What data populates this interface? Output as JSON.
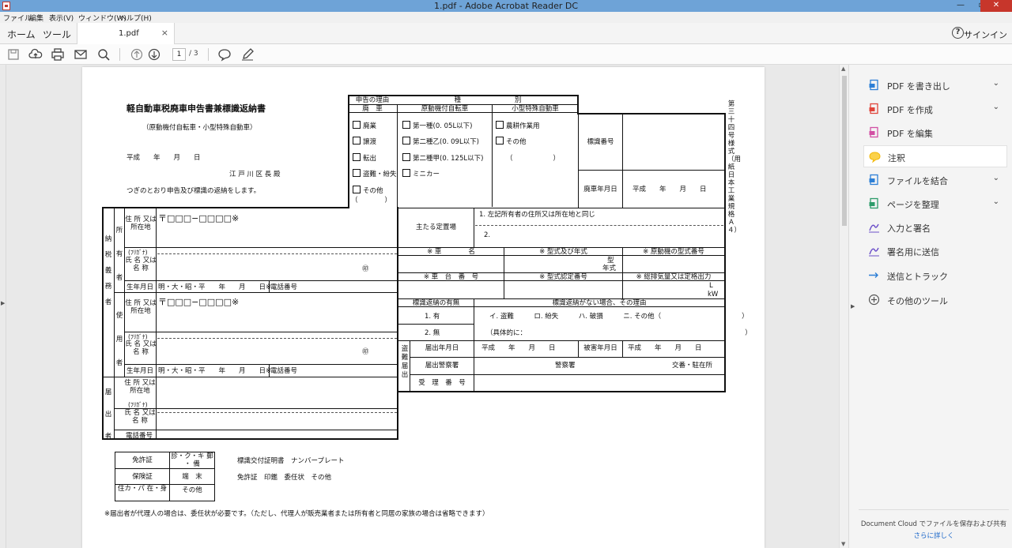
{
  "window": {
    "title": "1.pdf - Adobe Acrobat Reader DC",
    "min": "—",
    "max": "▫",
    "close": "✕"
  },
  "menu": [
    "ファイル",
    "編集",
    "表示(V)",
    "ウィンドウ(W)",
    "ヘルプ(H)"
  ],
  "tabs": {
    "home": "ホーム",
    "tools": "ツール",
    "doc": "1.pdf",
    "close": "×",
    "help": "?",
    "signin": "サインイン"
  },
  "toolbar": {
    "page_current": "1",
    "page_total": "/ 3"
  },
  "panel": {
    "items": [
      {
        "label": "PDF を書き出し",
        "chevron": "⌄",
        "icon": "export-pdf-icon",
        "color": "#2d7fd6"
      },
      {
        "label": "PDF を作成",
        "chevron": "⌄",
        "icon": "create-pdf-icon",
        "color": "#e0443a"
      },
      {
        "label": "PDF を編集",
        "chevron": "",
        "icon": "edit-pdf-icon",
        "color": "#d24fa3"
      },
      {
        "label": "注釈",
        "chevron": "",
        "icon": "comment-icon",
        "color": "#f2b705"
      },
      {
        "label": "ファイルを結合",
        "chevron": "⌄",
        "icon": "combine-files-icon",
        "color": "#2d7fd6"
      },
      {
        "label": "ページを整理",
        "chevron": "⌄",
        "icon": "organize-pages-icon",
        "color": "#2d9c6a"
      },
      {
        "label": "入力と署名",
        "chevron": "",
        "icon": "fill-sign-icon",
        "color": "#6b4fc9"
      },
      {
        "label": "署名用に送信",
        "chevron": "",
        "icon": "send-for-signature-icon",
        "color": "#6b4fc9"
      },
      {
        "label": "送信とトラック",
        "chevron": "",
        "icon": "send-track-icon",
        "color": "#2d7fd6"
      },
      {
        "label": "その他のツール",
        "chevron": "",
        "icon": "more-tools-icon",
        "color": "#555555"
      }
    ],
    "cloud_text": "Document Cloud でファイルを保存および共有",
    "cloud_link": "さらに詳しく"
  },
  "form": {
    "title": "軽自動車税廃車申告書兼標識返納書",
    "subtitle": "（原動機付自転車・小型特殊自動車）",
    "date": "平成　　年　　月　　日",
    "recipient": "江 戸 川 区 長 殿",
    "intro": "つぎのとおり申告及び標識の返納をします。",
    "reason_head": "申告の理由",
    "kind_head": "種　　　　　　　　別",
    "haisha": "廃　車",
    "gentsuki": "原動機付自転車",
    "kogata": "小型特殊自動車",
    "reasons": [
      "廃業",
      "譲渡",
      "転出",
      "盗難・紛失",
      "その他"
    ],
    "reason_paren": "（　　　　）",
    "classes": [
      "第一種(0. 05L以下)",
      "第二種乙(0. 09L以下)",
      "第二種甲(0. 125L以下)",
      "ミニカー"
    ],
    "kogata_opts": [
      "農耕作業用",
      "その他"
    ],
    "kogata_paren": "（　　　　　　）",
    "hyoshiki_bango": "標識番号",
    "haisha_date_label": "廃車年月日",
    "haisha_date": "平成　　年　　月　　日",
    "side_note": "第三十四号様式（用紙日本工業規格Ａ４）",
    "nozei": "納税義務者",
    "shoyu": "所有者",
    "shiyo": "使用者",
    "todoke": "届出者",
    "addr_label": "住 所 又は 所在地",
    "zip": "〒□□□−□□□□※",
    "furigana": "(ﾌﾘｶﾞﾅ)",
    "name_label": "氏 名 又は 名 称",
    "seal": "㊞",
    "birth_label": "生年月日",
    "birth_value": "明・大・昭・平　　年　　月　　日※",
    "phone": "電話番号",
    "teichi": "主たる定置場",
    "teichi_1": "1. 左記所有者の住所又は所在地と同じ",
    "teichi_2": "2.",
    "shamei": "※ 車　　　　名",
    "katashiki": "※ 型式及び年式",
    "genmotor": "※ 原動機の型式番号",
    "kata": "型",
    "nenshiki": "年式",
    "shadai": "※ 車　台　番　号",
    "katanin": "※ 型式認定番号",
    "haiki": "※ 総排気量又は定格出力",
    "l_unit": "L",
    "kw_unit": "kW",
    "henno_umu": "標識返納の有無",
    "henno_nai": "標識返納がない場合、その理由",
    "umu_1": "1. 有",
    "umu_2": "2. 無",
    "riyu_line": "イ. 盗難　　　ロ. 紛失　　　ハ. 破損　　　ニ. その他（　　　　　　　　　　　　）",
    "gutai": "（具体的に：　　　　　　　　　　　　　　　　　　　　　　　　　　　　　　　　　）",
    "tonan": "盗難届出",
    "todoke_date": "届出年月日",
    "todoke_date_val": "平成　　年　　月　　日",
    "higai_date": "被害年月日",
    "higai_date_val": "平成　　年　　月　　日",
    "keisatsu_label": "届出警察署",
    "keisatsu": "警察署",
    "koban": "交番・駐在所",
    "juri": "受　理　番　号",
    "docs": [
      [
        "免許証",
        "診・ク・キ 郵 ・ 備"
      ],
      [
        "保険証",
        "端　末"
      ],
      [
        "住カ・パ 在・身",
        "その他"
      ]
    ],
    "cert_1": "標識交付証明書　ナンバープレート",
    "cert_2": "免許証　印鑑　委任状　その他",
    "footer": "※届出者が代理人の場合は、委任状が必要です。（ただし、代理人が販売業者または所有者と同居の家族の場合は省略できます）"
  }
}
